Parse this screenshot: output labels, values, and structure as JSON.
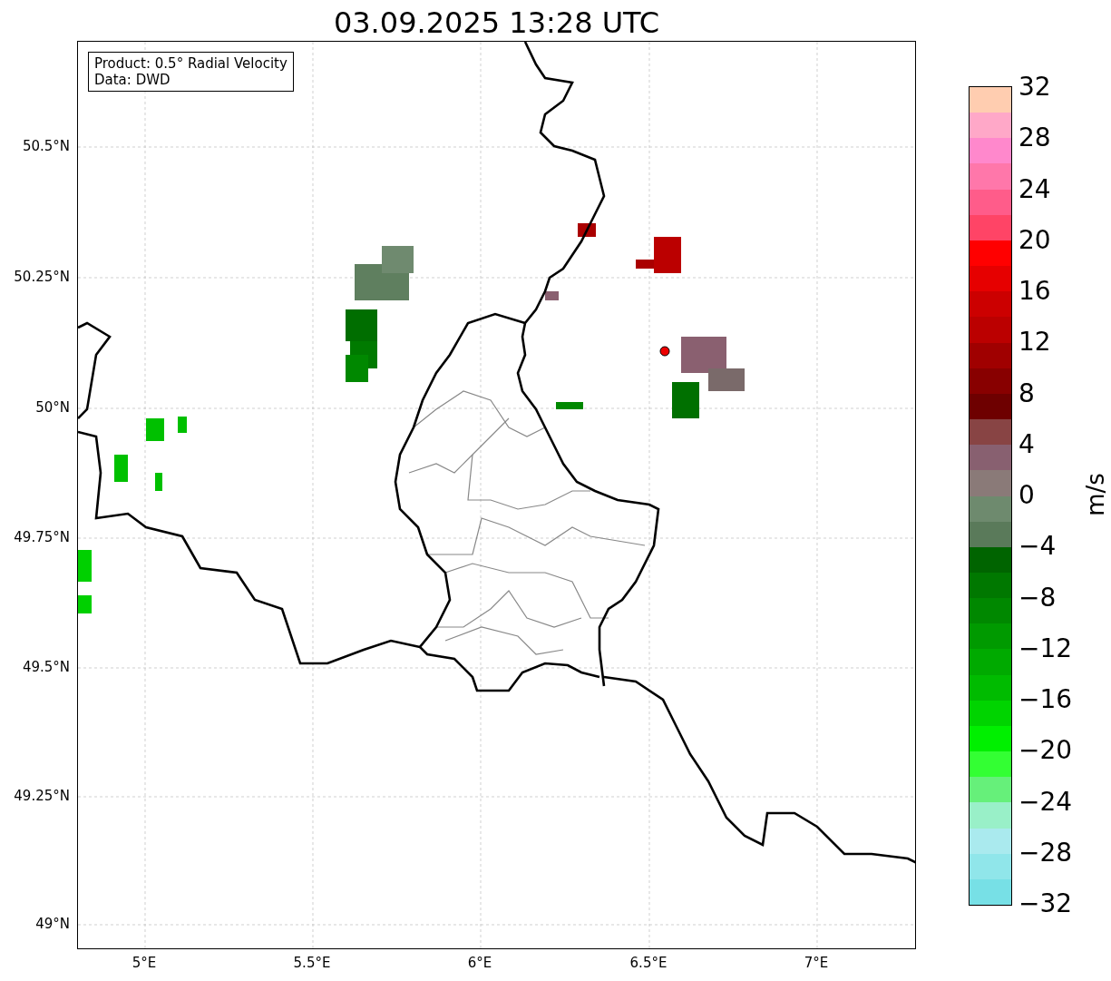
{
  "title": "03.09.2025 13:28 UTC",
  "info_box": {
    "lines": [
      "Product: 0.5° Radial Velocity",
      "Data: DWD"
    ]
  },
  "map": {
    "lat_ticks": [
      "50.5°N",
      "50.25°N",
      "50°N",
      "49.75°N",
      "49.5°N",
      "49.25°N",
      "49°N"
    ],
    "lon_ticks": [
      "5°E",
      "5.5°E",
      "6°E",
      "6.5°E",
      "7°E"
    ]
  },
  "colorbar": {
    "label": "m/s",
    "ticks": [
      "32",
      "28",
      "24",
      "20",
      "16",
      "12",
      "8",
      "4",
      "0",
      "−4",
      "−8",
      "−12",
      "−16",
      "−20",
      "−24",
      "−28",
      "−32"
    ],
    "segments": [
      {
        "color": "#ffcdb0"
      },
      {
        "color": "#ffa8c8"
      },
      {
        "color": "#ff88cc"
      },
      {
        "color": "#ff77aa"
      },
      {
        "color": "#ff5c8a"
      },
      {
        "color": "#ff4466"
      },
      {
        "color": "#ff0000"
      },
      {
        "color": "#e60000"
      },
      {
        "color": "#cc0000"
      },
      {
        "color": "#bb0000"
      },
      {
        "color": "#a00000"
      },
      {
        "color": "#880000"
      },
      {
        "color": "#6e0000"
      },
      {
        "color": "#884444"
      },
      {
        "color": "#886070"
      },
      {
        "color": "#8a7a78"
      },
      {
        "color": "#6e8a6e"
      },
      {
        "color": "#5a7a5a"
      },
      {
        "color": "#006400"
      },
      {
        "color": "#007800"
      },
      {
        "color": "#008800"
      },
      {
        "color": "#009a00"
      },
      {
        "color": "#00aa00"
      },
      {
        "color": "#00bb00"
      },
      {
        "color": "#00d400"
      },
      {
        "color": "#00f000"
      },
      {
        "color": "#33ff33"
      },
      {
        "color": "#66f07a"
      },
      {
        "color": "#99f0c8"
      },
      {
        "color": "#aaeaee"
      },
      {
        "color": "#90e6ea"
      },
      {
        "color": "#77e0e6"
      }
    ]
  }
}
